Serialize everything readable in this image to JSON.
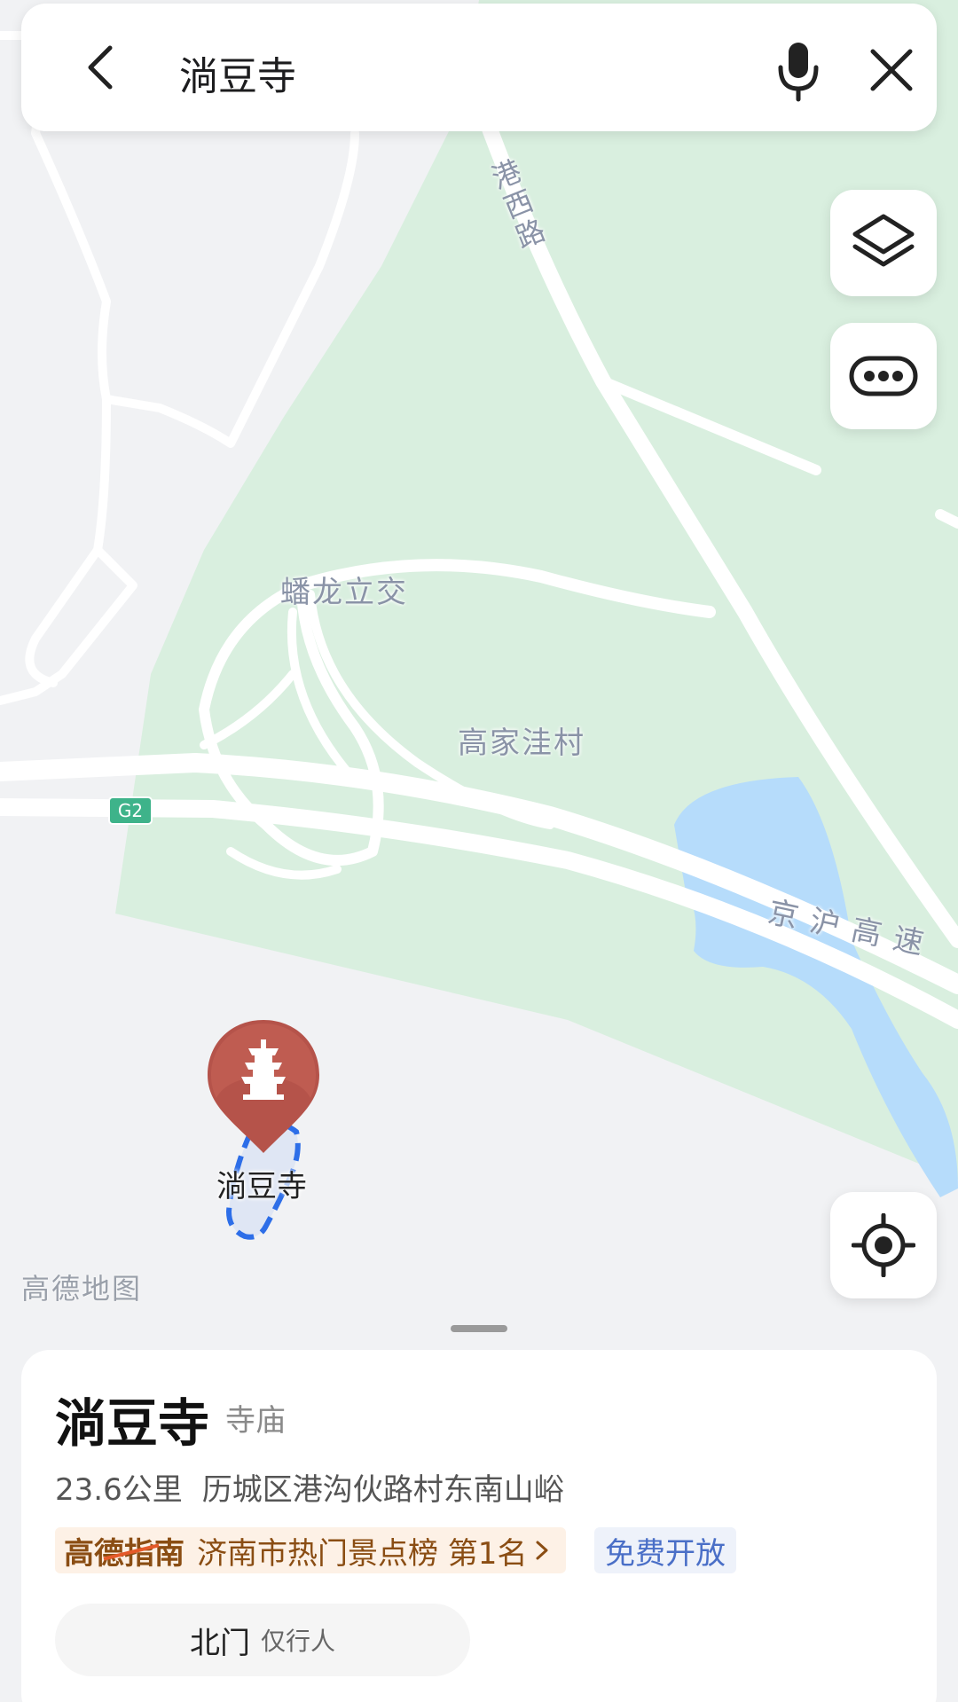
{
  "search": {
    "query": "淌豆寺"
  },
  "map": {
    "labels": {
      "road_gangxi": "港西路",
      "interchange": "蟠龙立交",
      "village": "高家洼村",
      "highway_badge": "G2",
      "highway_name": "京沪高速"
    },
    "poi": {
      "label": "淌豆寺",
      "icon": "pagoda-icon",
      "pin_color": "#b5534a"
    },
    "brand": "高德地图",
    "colors": {
      "land": "#f1f2f4",
      "park": "#d9efdf",
      "water": "#b6dcfb",
      "road": "#ffffff",
      "boundary": "#2d6ee8"
    }
  },
  "controls": {
    "layers_icon": "layers-icon",
    "more_icon": "more-icon",
    "locate_icon": "locate-icon"
  },
  "place": {
    "name": "淌豆寺",
    "category": "寺庙",
    "distance": "23.6公里",
    "address": "历城区港沟伙路村东南山峪",
    "guide_logo": "高德指南",
    "rank_text": "济南市热门景点榜 第1名",
    "free_tag": "免费开放",
    "entrance": {
      "name": "北门",
      "note": "仅行人"
    }
  }
}
